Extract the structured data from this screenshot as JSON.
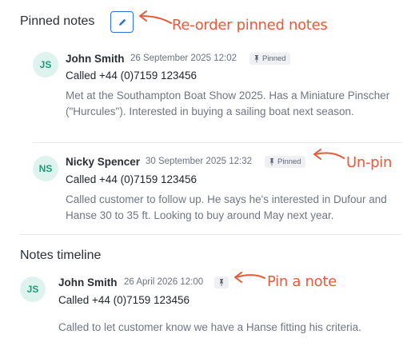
{
  "pinned_section": {
    "title": "Pinned notes",
    "notes": [
      {
        "initials": "JS",
        "author": "John Smith",
        "date": "26 September 2025 12:02",
        "badge": "Pinned",
        "subject": "Called +44 (0)7159 123456",
        "body": "Met at the Southampton Boat Show 2025. Has a Miniature Pinscher (\"Hurcules\"). Interested in buying a sailing boat next season."
      },
      {
        "initials": "NS",
        "author": "Nicky Spencer",
        "date": "30 September 2025 12:32",
        "badge": "Pinned",
        "subject": "Called +44 (0)7159 123456",
        "body": "Called customer to follow up. He says he's interested in Dufour and Hanse 30 to 35 ft. Looking to buy around May next year."
      }
    ]
  },
  "timeline_section": {
    "title": "Notes timeline",
    "notes": [
      {
        "initials": "JS",
        "author": "John Smith",
        "date": "26 April 2026 12:00",
        "subject": "Called +44 (0)7159 123456",
        "body": "Called to let customer know we have a Hanse fitting his criteria."
      }
    ]
  },
  "annotations": {
    "reorder": "Re-order pinned notes",
    "unpin": "Un-pin",
    "pin": "Pin a note"
  },
  "icons": {
    "edit": "pencil-icon",
    "pin": "pin-icon"
  },
  "colors": {
    "accent": "#2a72d6",
    "avatar_bg": "#dff3ee",
    "avatar_text": "#1e9a7a",
    "annotation": "#e85a3a"
  }
}
